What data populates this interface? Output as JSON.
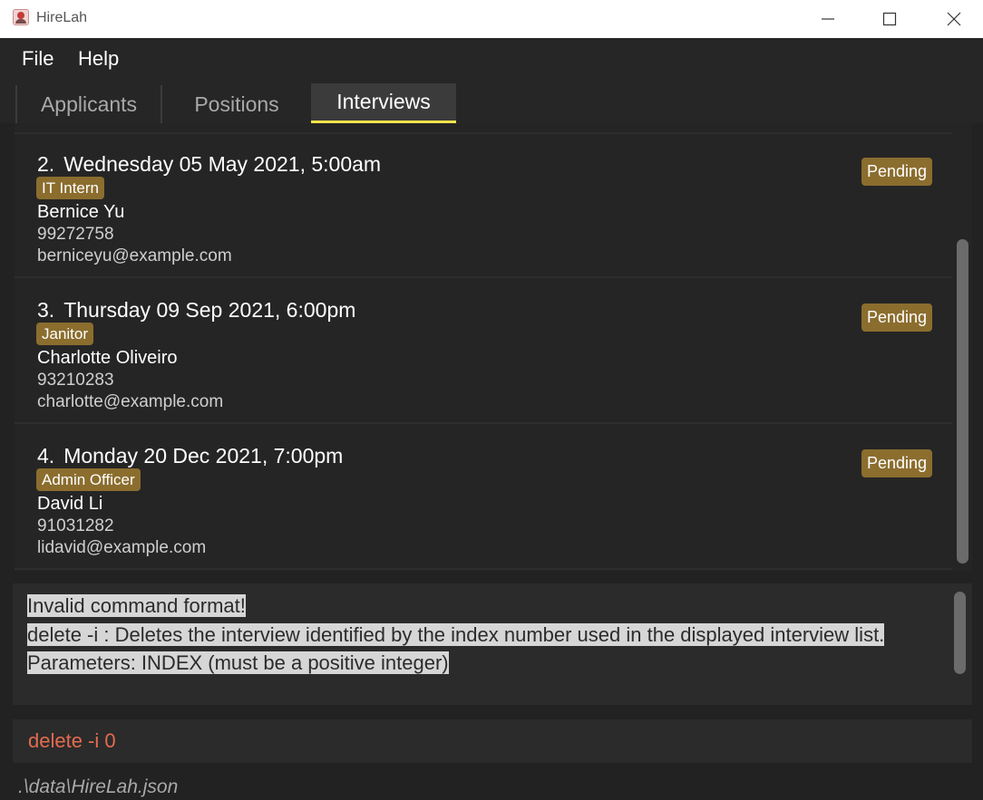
{
  "window": {
    "title": "HireLah",
    "icon": "hirelah-logo-icon"
  },
  "menu": {
    "items": [
      "File",
      "Help"
    ]
  },
  "tabs": [
    {
      "label": "Applicants",
      "selected": false
    },
    {
      "label": "Positions",
      "selected": false
    },
    {
      "label": "Interviews",
      "selected": true
    }
  ],
  "colors": {
    "background": "#222222",
    "tag": "#8b6d2e",
    "active_tab_underline": "#f2e34a",
    "command_text": "#e46b4f"
  },
  "interviews": [
    {
      "index": "2.",
      "datetime": "Wednesday 05 May 2021, 5:00am",
      "position": "IT Intern",
      "name": "Bernice Yu",
      "phone": "99272758",
      "email": "berniceyu@example.com",
      "status": "Pending"
    },
    {
      "index": "3.",
      "datetime": "Thursday 09 Sep 2021, 6:00pm",
      "position": "Janitor",
      "name": "Charlotte Oliveiro",
      "phone": "93210283",
      "email": "charlotte@example.com",
      "status": "Pending"
    },
    {
      "index": "4.",
      "datetime": "Monday 20 Dec 2021, 7:00pm",
      "position": "Admin Officer",
      "name": "David Li",
      "phone": "91031282",
      "email": "lidavid@example.com",
      "status": "Pending"
    }
  ],
  "result": {
    "lines": [
      "Invalid command format!",
      "delete -i : Deletes the interview identified by the index number used in the displayed interview list.",
      "Parameters: INDEX (must be a positive integer)"
    ]
  },
  "command": {
    "value": "delete -i 0"
  },
  "status": {
    "path": ".\\data\\HireLah.json"
  }
}
